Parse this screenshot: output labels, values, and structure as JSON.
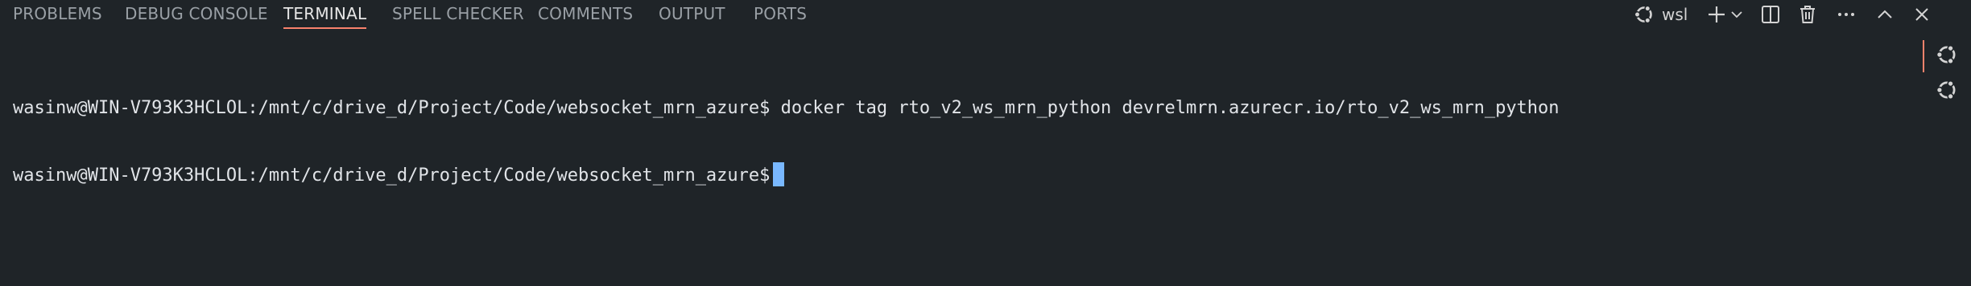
{
  "tabs": [
    {
      "label": "PROBLEMS"
    },
    {
      "label": "DEBUG CONSOLE"
    },
    {
      "label": "TERMINAL",
      "active": true
    },
    {
      "label": "SPELL CHECKER"
    },
    {
      "label": "COMMENTS"
    },
    {
      "label": "OUTPUT"
    },
    {
      "label": "PORTS"
    }
  ],
  "toolbar": {
    "terminal_profile": "wsl",
    "icons": [
      "ubuntu-icon",
      "plus-icon",
      "chevron-down-icon",
      "split-icon",
      "trash-icon",
      "ellipsis-icon",
      "chevron-up-icon",
      "close-icon"
    ]
  },
  "terminal": {
    "lines": [
      "wasinw@WIN-V793K3HCLOL:/mnt/c/drive_d/Project/Code/websocket_mrn_azure$ docker tag rto_v2_ws_mrn_python devrelmrn.azurecr.io/rto_v2_ws_mrn_python",
      "wasinw@WIN-V793K3HCLOL:/mnt/c/drive_d/Project/Code/websocket_mrn_azure$"
    ]
  },
  "side_terminals": [
    {
      "icon": "ubuntu-icon",
      "active": true
    },
    {
      "icon": "ubuntu-icon",
      "active": false
    }
  ],
  "colors": {
    "background": "#1f2428",
    "accent": "#f9826c",
    "cursor": "#79b8ff"
  }
}
